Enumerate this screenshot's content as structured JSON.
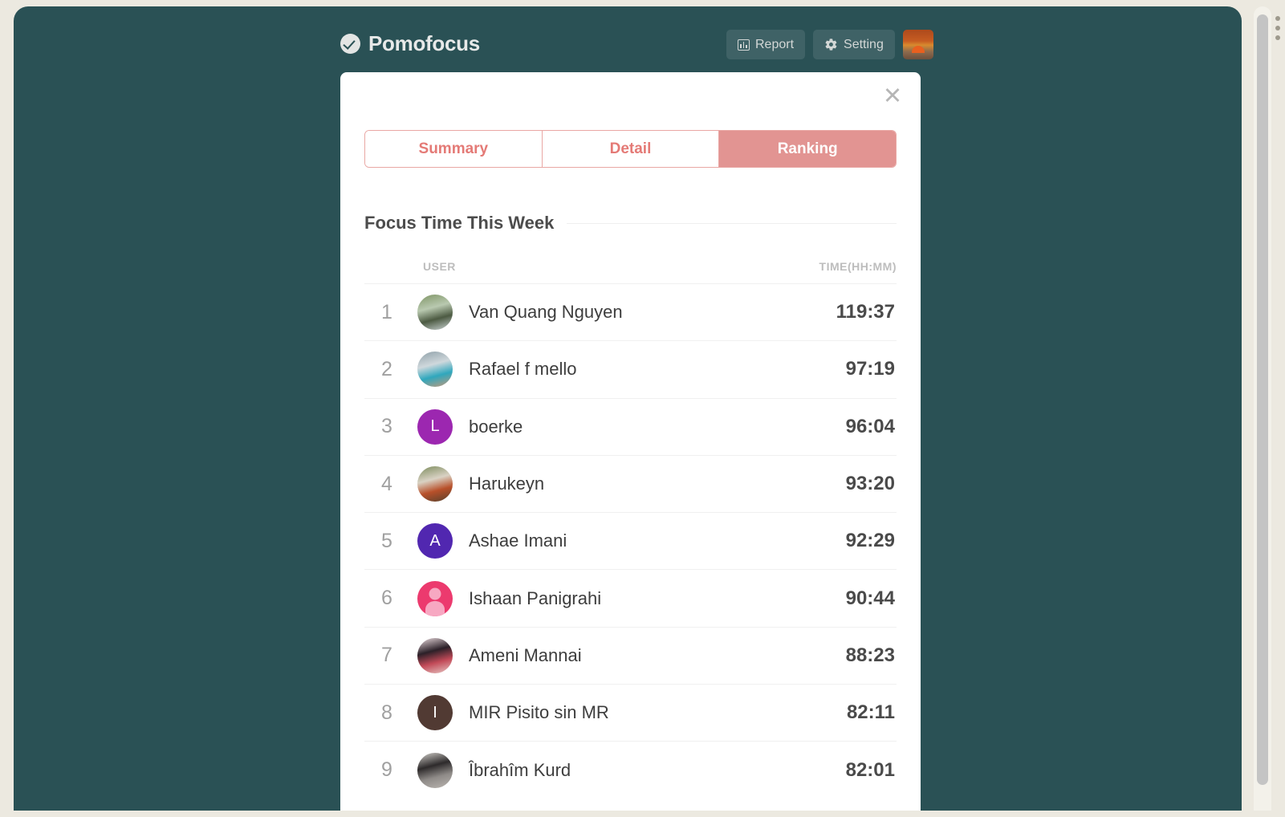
{
  "app": {
    "brand": "Pomofocus",
    "brand_icon": "check-circle-icon",
    "background_color": "#2a5155"
  },
  "header": {
    "report_button": {
      "label": "Report",
      "icon": "bar-chart-icon"
    },
    "setting_button": {
      "label": "Setting",
      "icon": "gear-icon"
    },
    "user_avatar": {
      "icon": "user-avatar-image"
    }
  },
  "modal": {
    "close_icon": "close-icon",
    "tabs": [
      {
        "label": "Summary",
        "active": false
      },
      {
        "label": "Detail",
        "active": false
      },
      {
        "label": "Ranking",
        "active": true
      }
    ],
    "section": {
      "title": "Focus Time This Week"
    },
    "table": {
      "headers": {
        "rank": "",
        "user": "USER",
        "time": "TIME(HH:MM)"
      },
      "rows": [
        {
          "rank": "1",
          "name": "Van Quang Nguyen",
          "time": "119:37",
          "avatar": {
            "type": "photo",
            "palette": [
              "#7e9464",
              "#b9c9b0",
              "#4c5a42",
              "#cdd6d6"
            ]
          }
        },
        {
          "rank": "2",
          "name": "Rafael f mello",
          "time": "97:19",
          "avatar": {
            "type": "photo",
            "palette": [
              "#8fa0a8",
              "#cfd8dc",
              "#2fa7bd",
              "#c89878"
            ]
          }
        },
        {
          "rank": "3",
          "name": "boerke",
          "time": "96:04",
          "avatar": {
            "type": "letter",
            "letter": "L",
            "color": "#9c27b0"
          }
        },
        {
          "rank": "4",
          "name": "Harukeyn",
          "time": "93:20",
          "avatar": {
            "type": "photo",
            "palette": [
              "#7a8a5a",
              "#d9d2c4",
              "#b8502a",
              "#54402c"
            ]
          }
        },
        {
          "rank": "5",
          "name": "Ashae Imani",
          "time": "92:29",
          "avatar": {
            "type": "letter",
            "letter": "A",
            "color": "#5127b0"
          }
        },
        {
          "rank": "6",
          "name": "Ishaan Panigrahi",
          "time": "90:44",
          "avatar": {
            "type": "silhouette",
            "color": "#ec3a6e",
            "fg": "#f7a8c2"
          }
        },
        {
          "rank": "7",
          "name": "Ameni Mannai",
          "time": "88:23",
          "avatar": {
            "type": "photo",
            "palette": [
              "#efdfe2",
              "#2b2028",
              "#c24a58",
              "#e8c9c6"
            ]
          }
        },
        {
          "rank": "8",
          "name": "MIR Pisito sin MR",
          "time": "82:11",
          "avatar": {
            "type": "letter",
            "letter": "I",
            "color": "#513a33"
          }
        },
        {
          "rank": "9",
          "name": "Îbrahîm Kurd",
          "time": "82:01",
          "avatar": {
            "type": "photo",
            "palette": [
              "#d5d2cd",
              "#2d2a2b",
              "#8f8b88",
              "#bbb6b1"
            ]
          }
        }
      ]
    }
  },
  "chrome": {
    "menu_icon": "vertical-dots-icon",
    "scrollbar": "vertical-scrollbar"
  }
}
